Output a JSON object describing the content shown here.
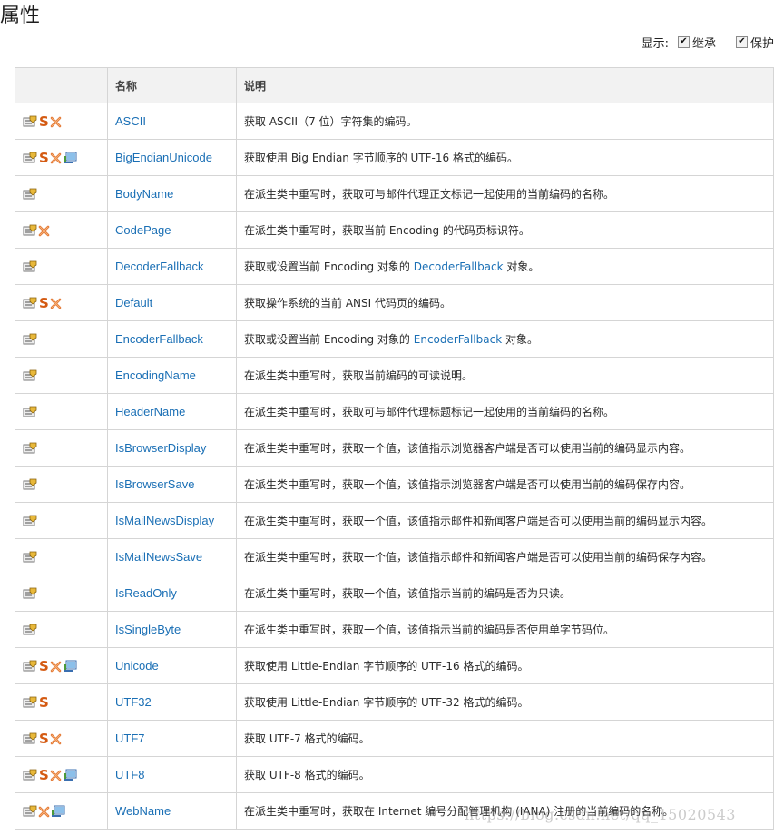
{
  "page": {
    "title": "属性"
  },
  "filter": {
    "label": "显示:",
    "options": [
      {
        "label": "继承",
        "checked": true
      },
      {
        "label": "保护",
        "checked": true
      }
    ]
  },
  "table": {
    "headers": [
      "",
      "名称",
      "说明"
    ],
    "rows": [
      {
        "icons": [
          "property-icon",
          "static-icon",
          "xna-icon"
        ],
        "name": "ASCII",
        "desc": [
          "获取 ASCII（7 位）字符集的编码。"
        ]
      },
      {
        "icons": [
          "property-icon",
          "static-icon",
          "xna-icon",
          "portable-icon"
        ],
        "name": "BigEndianUnicode",
        "desc": [
          "获取使用 Big Endian 字节顺序的 UTF-16 格式的编码。"
        ]
      },
      {
        "icons": [
          "property-icon"
        ],
        "name": "BodyName",
        "desc": [
          "在派生类中重写时，获取可与邮件代理正文标记一起使用的当前编码的名称。"
        ]
      },
      {
        "icons": [
          "property-icon",
          "xna-icon"
        ],
        "name": "CodePage",
        "desc": [
          "在派生类中重写时，获取当前 Encoding 的代码页标识符。"
        ]
      },
      {
        "icons": [
          "property-icon"
        ],
        "name": "DecoderFallback",
        "desc": [
          "获取或设置当前 Encoding 对象的 ",
          "DecoderFallback",
          " 对象。"
        ]
      },
      {
        "icons": [
          "property-icon",
          "static-icon",
          "xna-icon"
        ],
        "name": "Default",
        "desc": [
          "获取操作系统的当前 ANSI 代码页的编码。"
        ]
      },
      {
        "icons": [
          "property-icon"
        ],
        "name": "EncoderFallback",
        "desc": [
          "获取或设置当前 Encoding 对象的 ",
          "EncoderFallback",
          " 对象。"
        ]
      },
      {
        "icons": [
          "property-icon"
        ],
        "name": "EncodingName",
        "desc": [
          "在派生类中重写时，获取当前编码的可读说明。"
        ]
      },
      {
        "icons": [
          "property-icon"
        ],
        "name": "HeaderName",
        "desc": [
          "在派生类中重写时，获取可与邮件代理标题标记一起使用的当前编码的名称。"
        ]
      },
      {
        "icons": [
          "property-icon"
        ],
        "name": "IsBrowserDisplay",
        "desc": [
          "在派生类中重写时，获取一个值，该值指示浏览器客户端是否可以使用当前的编码显示内容。"
        ]
      },
      {
        "icons": [
          "property-icon"
        ],
        "name": "IsBrowserSave",
        "desc": [
          "在派生类中重写时，获取一个值，该值指示浏览器客户端是否可以使用当前的编码保存内容。"
        ]
      },
      {
        "icons": [
          "property-icon"
        ],
        "name": "IsMailNewsDisplay",
        "desc": [
          "在派生类中重写时，获取一个值，该值指示邮件和新闻客户端是否可以使用当前的编码显示内容。"
        ]
      },
      {
        "icons": [
          "property-icon"
        ],
        "name": "IsMailNewsSave",
        "desc": [
          "在派生类中重写时，获取一个值，该值指示邮件和新闻客户端是否可以使用当前的编码保存内容。"
        ]
      },
      {
        "icons": [
          "property-icon"
        ],
        "name": "IsReadOnly",
        "desc": [
          "在派生类中重写时，获取一个值，该值指示当前的编码是否为只读。"
        ]
      },
      {
        "icons": [
          "property-icon"
        ],
        "name": "IsSingleByte",
        "desc": [
          "在派生类中重写时，获取一个值，该值指示当前的编码是否使用单字节码位。"
        ]
      },
      {
        "icons": [
          "property-icon",
          "static-icon",
          "xna-icon",
          "portable-icon"
        ],
        "name": "Unicode",
        "desc": [
          "获取使用 Little-Endian 字节顺序的 UTF-16 格式的编码。"
        ]
      },
      {
        "icons": [
          "property-icon",
          "static-icon"
        ],
        "name": "UTF32",
        "desc": [
          "获取使用 Little-Endian 字节顺序的 UTF-32 格式的编码。"
        ]
      },
      {
        "icons": [
          "property-icon",
          "static-icon",
          "xna-icon"
        ],
        "name": "UTF7",
        "desc": [
          "获取 UTF-7 格式的编码。"
        ]
      },
      {
        "icons": [
          "property-icon",
          "static-icon",
          "xna-icon",
          "portable-icon"
        ],
        "name": "UTF8",
        "desc": [
          "获取 UTF-8 格式的编码。"
        ]
      },
      {
        "icons": [
          "property-icon",
          "xna-icon",
          "portable-icon"
        ],
        "name": "WebName",
        "desc": [
          "在派生类中重写时，获取在 Internet 编号分配管理机构 (IANA) 注册的当前编码的名称。"
        ]
      }
    ]
  },
  "watermark": "https://blog.csdn.net/qq_15020543",
  "colors": {
    "link": "#1a6fb5",
    "header_bg": "#f2f2f2",
    "border": "#d5d5d5",
    "static_icon": "#d45a12"
  }
}
